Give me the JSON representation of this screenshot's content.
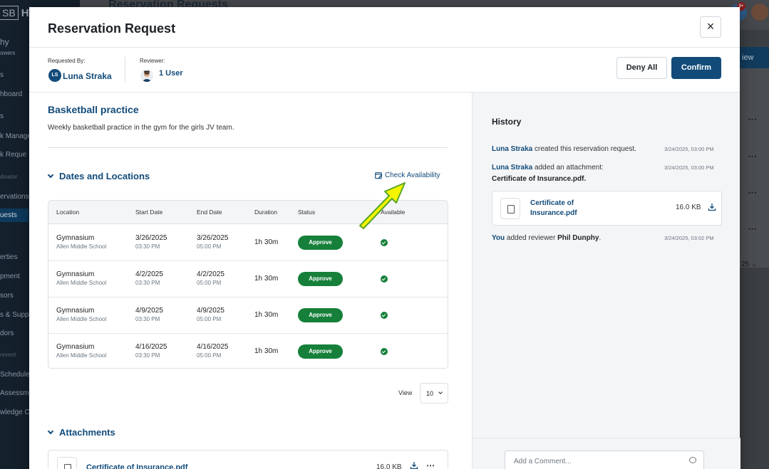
{
  "background": {
    "logo_text": "SB",
    "logo_letter": "H",
    "page_title": "Reservation Requests",
    "nav_items": [
      "hy",
      "owers",
      "s",
      "hboard",
      "s",
      "k Manage",
      "k Reque",
      "dinator",
      "ervations",
      "uests",
      "erties",
      "pment",
      "sors",
      "s & Supp",
      "dors",
      "revent",
      "Schedule",
      "Assessm",
      "wledge C"
    ],
    "list_button": "iew",
    "page_size": "25",
    "notification_count": "9+"
  },
  "modal": {
    "title": "Reservation Request",
    "close_label": "×",
    "requested_by_label": "Requested By:",
    "requester_initials": "LS",
    "requester_name": "Luna Straka",
    "reviewer_label": "Reviewer:",
    "reviewer_count": "1 User",
    "deny_all_label": "Deny All",
    "confirm_label": "Confirm"
  },
  "details": {
    "title": "Basketball practice",
    "description": "Weekly basketball practice in the gym for the girls JV team."
  },
  "dates_locations": {
    "section_title": "Dates and Locations",
    "check_availability": "Check Availability",
    "columns": [
      "Location",
      "Start Date",
      "End Date",
      "Duration",
      "Status",
      "Available"
    ],
    "rows": [
      {
        "location": "Gymnasium",
        "school": "Allen Middle School",
        "start_date": "3/26/2025",
        "start_time": "03:30 PM",
        "end_date": "3/26/2025",
        "end_time": "05:00 PM",
        "duration": "1h 30m",
        "status": "Approve"
      },
      {
        "location": "Gymnasium",
        "school": "Allen Middle School",
        "start_date": "4/2/2025",
        "start_time": "03:30 PM",
        "end_date": "4/2/2025",
        "end_time": "05:00 PM",
        "duration": "1h 30m",
        "status": "Approve"
      },
      {
        "location": "Gymnasium",
        "school": "Allen Middle School",
        "start_date": "4/9/2025",
        "start_time": "03:30 PM",
        "end_date": "4/9/2025",
        "end_time": "05:00 PM",
        "duration": "1h 30m",
        "status": "Approve"
      },
      {
        "location": "Gymnasium",
        "school": "Allen Middle School",
        "start_date": "4/16/2025",
        "start_time": "03:30 PM",
        "end_date": "4/16/2025",
        "end_time": "05:00 PM",
        "duration": "1h 30m",
        "status": "Approve"
      }
    ],
    "view_label": "View",
    "view_value": "10"
  },
  "attachments": {
    "section_title": "Attachments",
    "file_name": "Certificate of Insurance.pdf",
    "file_size": "16.0 KB"
  },
  "history": {
    "title": "History",
    "events": [
      {
        "actor": "Luna Straka",
        "text": " created this reservation request.",
        "time": "3/24/2025, 03:00 PM"
      },
      {
        "actor": "Luna Straka",
        "text": " added an attachment:",
        "detail": "Certificate of Insurance.pdf.",
        "time": "3/24/2025, 03:00 PM"
      },
      {
        "actor": "You",
        "text": " added reviewer ",
        "target": "Phil Dunphy",
        "end": ".",
        "time": "3/24/2025, 03:02 PM"
      }
    ],
    "file_name": "Certificate of Insurance.pdf",
    "file_size": "16.0 KB",
    "comment_placeholder": "Add a Comment..."
  },
  "colors": {
    "primary": "#124b7a",
    "approve": "#16803a",
    "arrow_fill": "#f5f500",
    "arrow_stroke": "#5aa52a"
  }
}
